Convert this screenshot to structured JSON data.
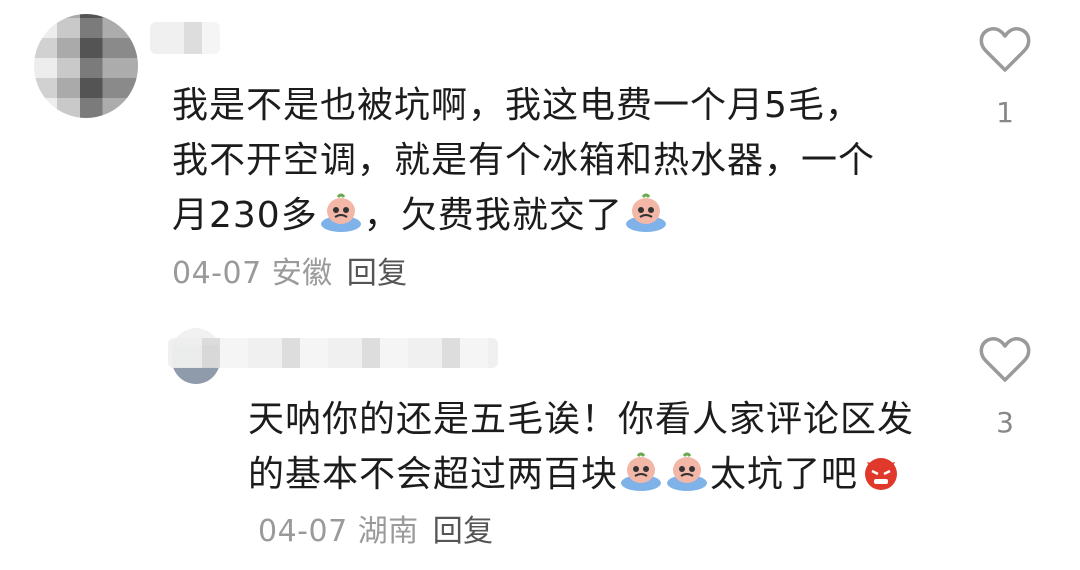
{
  "comments": [
    {
      "text_part1": "我是不是也被坑啊，我这电费一个月5毛，我不开空调，就是有个冰箱和热水器，一个月230多",
      "text_part2": "，欠费我就交了",
      "date": "04-07",
      "location": "安徽",
      "reply_label": "回复",
      "like_count": "1",
      "emojis": [
        "crying-sticker-emoji",
        "crying-sticker-emoji"
      ]
    },
    {
      "text_part1": "天呐你的还是五毛诶！你看人家评论区发的基本不会超过两百块",
      "text_part2": "太坑了吧",
      "date": "04-07",
      "location": "湖南",
      "reply_label": "回复",
      "like_count": "3",
      "emojis": [
        "crying-sticker-emoji",
        "crying-sticker-emoji",
        "angry-devil-emoji"
      ]
    }
  ],
  "colors": {
    "text": "#1c1c1c",
    "meta": "#9a9a9a",
    "reply": "#555555",
    "heart_outline": "#9a9a9a",
    "sticker_blue": "#7fb2e8",
    "sticker_pink": "#f3b7a8",
    "angry_red": "#e0392b"
  }
}
